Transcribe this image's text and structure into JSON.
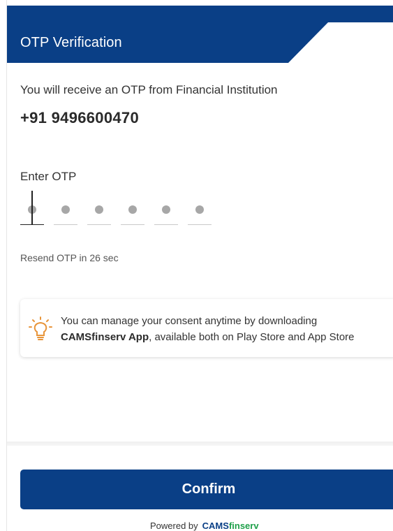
{
  "header": {
    "title": "OTP Verification"
  },
  "subtitle": "You will receive an OTP from Financial Institution",
  "phone": "+91 9496600470",
  "otp": {
    "label": "Enter OTP",
    "length": 6,
    "filled": 0
  },
  "resend": "Resend OTP in 26 sec",
  "info": {
    "line1": "You can manage your consent anytime by downloading",
    "app_name": "CAMSfinserv App",
    "line2_rest": ", available both on Play Store and App Store",
    "icon": "lightbulb-icon"
  },
  "confirm_label": "Confirm",
  "footer": {
    "powered_by": "Powered by",
    "brand_main": "CAMS",
    "brand_accent": "finserv"
  },
  "colors": {
    "primary": "#0a3f86",
    "accent_icon": "#e8953a",
    "brand_green": "#1fa04a"
  }
}
